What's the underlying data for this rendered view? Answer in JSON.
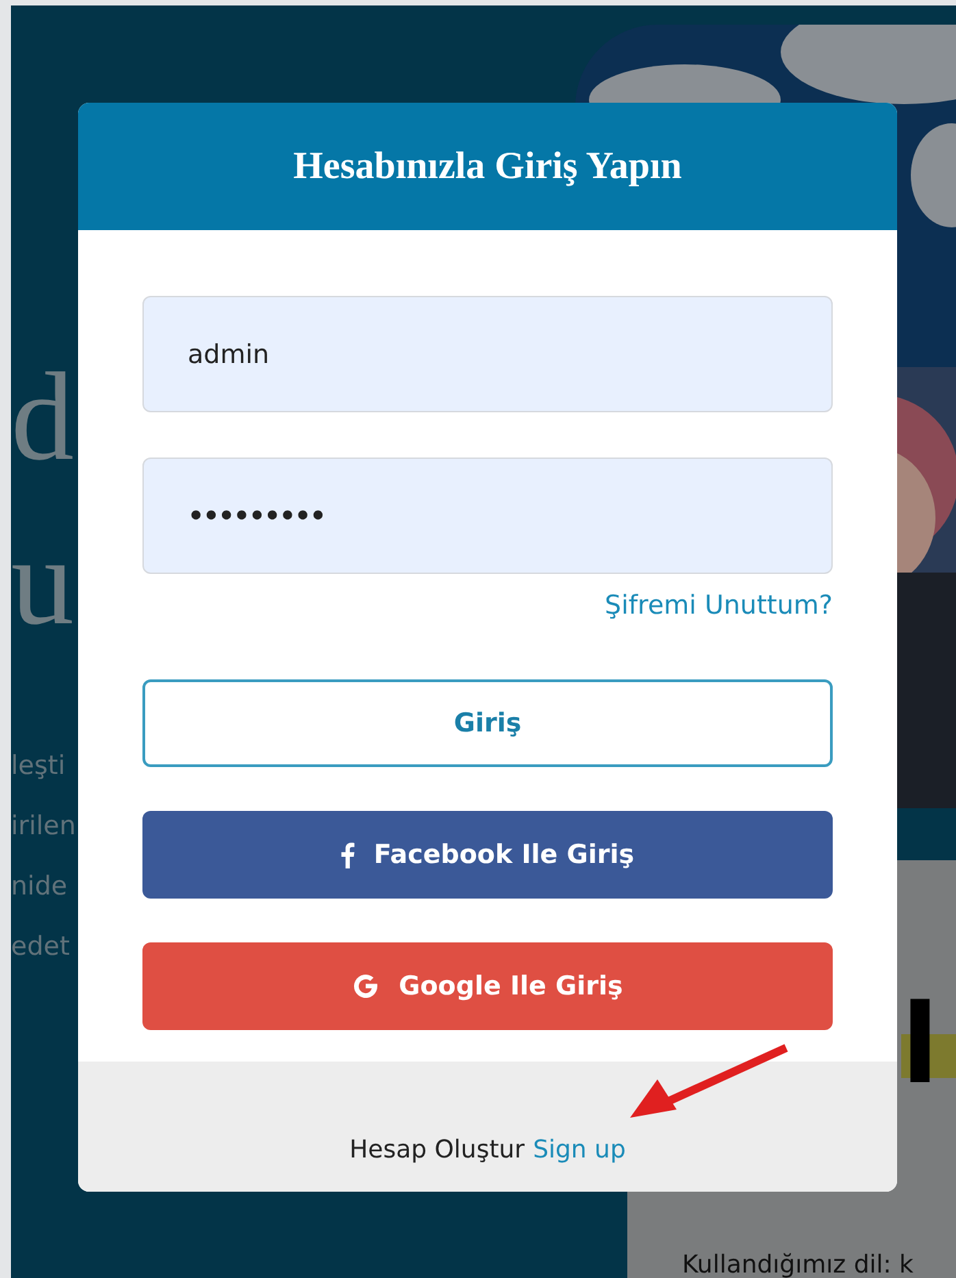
{
  "background": {
    "heading_fragments": [
      "d",
      "u"
    ],
    "text_fragments": [
      "leşti",
      "irilen",
      "nide",
      "edet"
    ],
    "picture": {
      "kind": "picture"
    },
    "card_heading": "l",
    "card_text": "Kullandığımız dil: k"
  },
  "modal": {
    "title": "Hesabınızla Giriş Yapın",
    "fields": [
      {
        "kind": "text",
        "value": "admin"
      },
      {
        "kind": "password",
        "value": "•••••••••"
      }
    ],
    "forgot_link": "Şifremi Unuttum?",
    "buttons": [
      {
        "kind": "outline",
        "label": "Giriş"
      },
      {
        "kind": "facebook",
        "label": "Facebook Ile Giriş"
      },
      {
        "kind": "google",
        "label": "Google Ile Giriş"
      }
    ],
    "footer": {
      "text": "Hesap Oluştur",
      "link": "Sign up"
    }
  }
}
